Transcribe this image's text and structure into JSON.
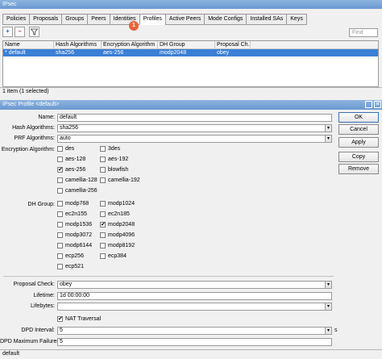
{
  "main_window": {
    "title": "IPsec",
    "tabs": [
      "Policies",
      "Proposals",
      "Groups",
      "Peers",
      "Identities",
      "Profiles",
      "Active Peers",
      "Mode Configs",
      "Installed SAs",
      "Keys"
    ],
    "active_tab": "Profiles",
    "annotation_badge": "1",
    "find_placeholder": "Find",
    "columns": [
      "Name",
      "Hash Algorithms",
      "Encryption Algorithm",
      "DH Group",
      "Proposal Ch..."
    ],
    "rows": [
      {
        "marker": "*",
        "name": "default",
        "hash": "sha256",
        "enc": "aes-256",
        "dh": "modp2048",
        "proposal": "obey"
      }
    ],
    "status": "1 item (1 selected)"
  },
  "profile_dialog": {
    "title": "IPsec Profile <default>",
    "name_label": "Name:",
    "name_value": "default",
    "hash_label": "Hash Algorithms:",
    "hash_value": "sha256",
    "prf_label": "PRF Algorithms:",
    "prf_value": "auto",
    "enc_label": "Encryption Algorithm:",
    "enc_options": [
      {
        "label": "des",
        "checked": false
      },
      {
        "label": "3des",
        "checked": false
      },
      {
        "label": "aes-128",
        "checked": false
      },
      {
        "label": "aes-192",
        "checked": false
      },
      {
        "label": "aes-256",
        "checked": true
      },
      {
        "label": "blowfish",
        "checked": false
      },
      {
        "label": "camellia-128",
        "checked": false
      },
      {
        "label": "camellia-192",
        "checked": false
      },
      {
        "label": "camellia-256",
        "checked": false
      }
    ],
    "dh_label": "DH Group:",
    "dh_options": [
      {
        "label": "modp768",
        "checked": false
      },
      {
        "label": "modp1024",
        "checked": false
      },
      {
        "label": "ec2n155",
        "checked": false
      },
      {
        "label": "ec2n185",
        "checked": false
      },
      {
        "label": "modp1536",
        "checked": false
      },
      {
        "label": "modp2048",
        "checked": true
      },
      {
        "label": "modp3072",
        "checked": false
      },
      {
        "label": "modp4096",
        "checked": false
      },
      {
        "label": "modp6144",
        "checked": false
      },
      {
        "label": "modp8192",
        "checked": false
      },
      {
        "label": "ecp256",
        "checked": false
      },
      {
        "label": "ecp384",
        "checked": false
      },
      {
        "label": "ecp521",
        "checked": false
      }
    ],
    "proposal_label": "Proposal Check:",
    "proposal_value": "obey",
    "lifetime_label": "Lifetime:",
    "lifetime_value": "1d 00:00:00",
    "lifebytes_label": "Lifebytes:",
    "lifebytes_value": "",
    "nat_label": "NAT Traversal",
    "nat_checked": true,
    "dpd_interval_label": "DPD Interval:",
    "dpd_interval_value": "5",
    "dpd_interval_unit": "s",
    "dpd_max_label": "DPD Maximum Failures:",
    "dpd_max_value": "5",
    "buttons": {
      "ok": "OK",
      "cancel": "Cancel",
      "apply": "Apply",
      "copy": "Copy",
      "remove": "Remove"
    },
    "status": "default"
  },
  "colors": {
    "selection": "#3a7fd6",
    "titlebar": "#7aa6da",
    "badge": "#e8633c"
  }
}
